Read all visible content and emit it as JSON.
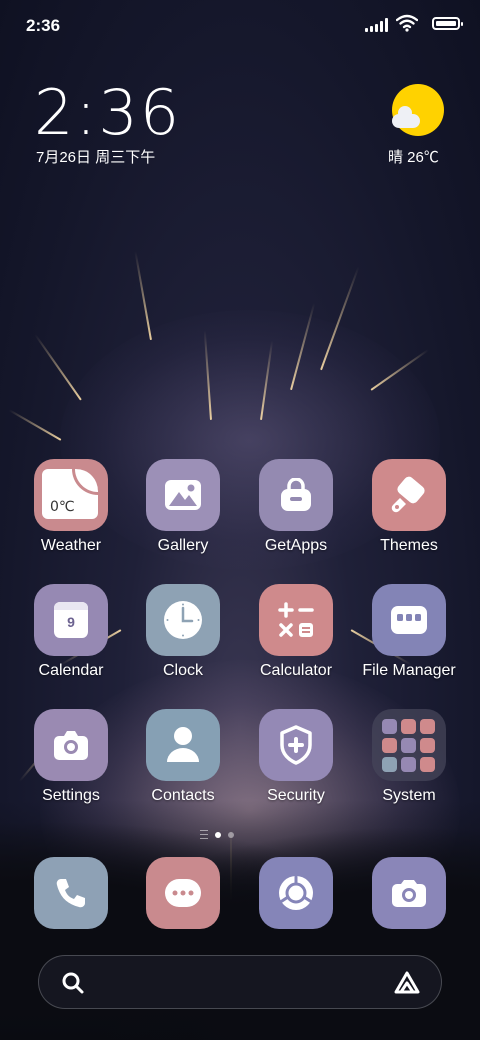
{
  "status_bar": {
    "time": "2:36",
    "signal_icon": "signal-icon",
    "wifi_icon": "wifi-icon",
    "battery_icon": "battery-icon"
  },
  "clock_widget": {
    "time": "2:36",
    "date": "7月26日 周三下午"
  },
  "weather_widget": {
    "icon": "sunny-cloud-icon",
    "text": "晴 26℃"
  },
  "apps": [
    {
      "label": "Weather",
      "icon": "weather-icon",
      "color": "#c98a8e",
      "widget_text": "0℃"
    },
    {
      "label": "Gallery",
      "icon": "gallery-icon",
      "color": "#9c90b7"
    },
    {
      "label": "GetApps",
      "icon": "getapps-icon",
      "color": "#948ab1"
    },
    {
      "label": "Themes",
      "icon": "themes-icon",
      "color": "#cf8a8c"
    },
    {
      "label": "Calendar",
      "icon": "calendar-icon",
      "color": "#9689b3",
      "widget_text": "9"
    },
    {
      "label": "Clock",
      "icon": "clock-icon",
      "color": "#8ea2b4"
    },
    {
      "label": "Calculator",
      "icon": "calculator-icon",
      "color": "#cf8a8c"
    },
    {
      "label": "File Manager",
      "icon": "folder-icon",
      "color": "#8384b6"
    },
    {
      "label": "Settings",
      "icon": "settings-icon",
      "color": "#9a8ab2"
    },
    {
      "label": "Contacts",
      "icon": "contacts-icon",
      "color": "#86a0b4"
    },
    {
      "label": "Security",
      "icon": "security-icon",
      "color": "#9489b5"
    },
    {
      "label": "System",
      "icon": "folder-system-icon",
      "color": "#3b3c4f"
    }
  ],
  "page_indicator": {
    "pages": 2,
    "current": 1
  },
  "dock": [
    {
      "name": "phone",
      "icon": "phone-icon",
      "color": "#8ea1b5"
    },
    {
      "name": "messages",
      "icon": "messages-icon",
      "color": "#c98a8e"
    },
    {
      "name": "browser",
      "icon": "browser-icon",
      "color": "#8585b8"
    },
    {
      "name": "camera",
      "icon": "camera-icon",
      "color": "#8a86b8"
    }
  ],
  "search_bar": {
    "search_icon": "search-icon",
    "assistant_icon": "assistant-icon"
  }
}
